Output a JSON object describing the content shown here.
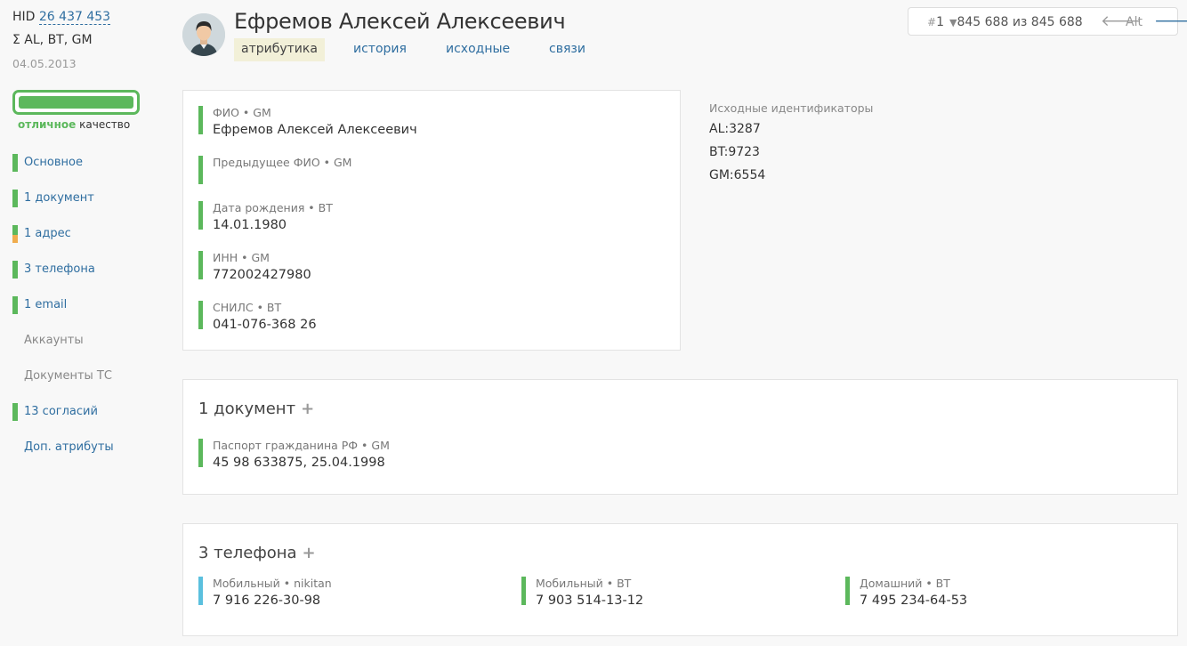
{
  "left": {
    "hid_label": "HID",
    "hid_value": "26 437 453",
    "sources": "Σ AL, BT, GM",
    "date": "04.05.2013",
    "quality_word": "отличное",
    "quality_rest": " качество",
    "quality_fill": 1.0,
    "nav": [
      {
        "label": "Основное"
      },
      {
        "label": "1 документ"
      },
      {
        "label": "1 адрес"
      },
      {
        "label": "3 телефона"
      },
      {
        "label": "1 email"
      },
      {
        "label": "Аккаунты"
      },
      {
        "label": "Документы ТС"
      },
      {
        "label": "13 согласий"
      },
      {
        "label": "Доп. атрибуты"
      }
    ]
  },
  "header": {
    "name": "Ефремов Алексей Алексеевич",
    "tabs": [
      "атрибутика",
      "история",
      "исходные",
      "связи"
    ],
    "pager": {
      "index_prefix": "#",
      "index": "1",
      "count": "845 688 из 845 688",
      "alt": "Alt"
    }
  },
  "attributes": [
    {
      "label": "ФИО • GM",
      "value": "Ефремов Алексей Алексеевич"
    },
    {
      "label": "Предыдущее ФИО • GM",
      "value": ""
    },
    {
      "label": "Дата рождения • BT",
      "value": "14.01.1980"
    },
    {
      "label": "ИНН • GM",
      "value": "772002427980"
    },
    {
      "label": "СНИЛС • BT",
      "value": "041-076-368 26"
    }
  ],
  "source_ids": {
    "title": "Исходные идентификаторы",
    "items": [
      "AL:3287",
      "BT:9723",
      "GM:6554"
    ]
  },
  "documents": {
    "title": "1 документ",
    "plus": "+",
    "items": [
      {
        "label": "Паспорт гражданина РФ • GM",
        "value": "45 98 633875, 25.04.1998"
      }
    ]
  },
  "phones": {
    "title": "3 телефона",
    "plus": "+",
    "items": [
      {
        "label": "Мобильный • nikitan",
        "value": "7 916 226-30-98"
      },
      {
        "label": "Мобильный • BT",
        "value": "7 903 514-13-12"
      },
      {
        "label": "Домашний • BT",
        "value": "7 495 234-64-53"
      }
    ]
  },
  "colors": {
    "accent": "#2f6ea0",
    "good": "#5cb85c",
    "warn": "#f0ad4e",
    "info": "#5bc0de",
    "tab_active_bg": "#f2f0d8"
  }
}
